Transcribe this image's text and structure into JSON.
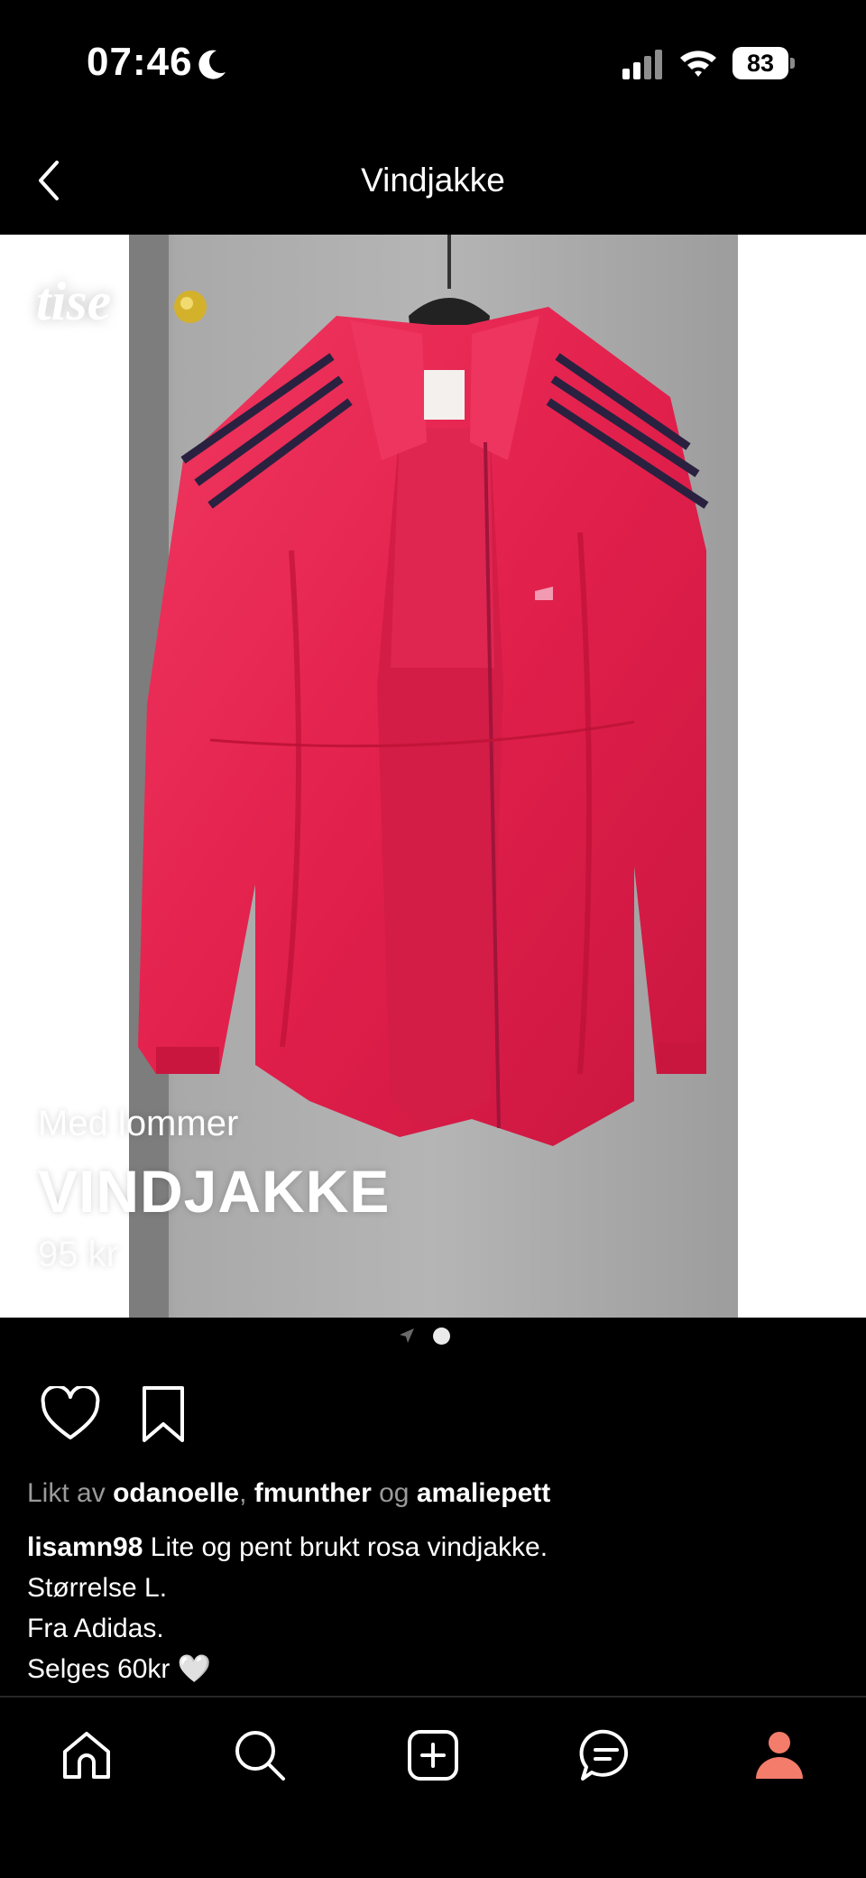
{
  "status_bar": {
    "time": "07:46",
    "battery": "83",
    "icons": [
      "moon-icon",
      "cellular-signal-icon",
      "wifi-icon",
      "battery-icon"
    ]
  },
  "header": {
    "title": "Vindjakke",
    "back_icon": "chevron-left-icon"
  },
  "post_image": {
    "logo": "tise",
    "subtitle": "Med lommer",
    "title": "VINDJAKKE",
    "price": "95 kr",
    "jacket_color": "#e8234e",
    "stripe_color": "#2a2140",
    "slide_count": 1
  },
  "actions": {
    "like_icon": "heart-icon",
    "save_icon": "bookmark-icon"
  },
  "likes": {
    "prefix": "Likt av",
    "user1": "odanoelle",
    "separator": ",",
    "user2": "fmunther",
    "conjunction": "og",
    "user3": "amaliepett"
  },
  "caption": {
    "username": "lisamn98",
    "line1": "Lite og pent brukt rosa vindjakke.",
    "line2": "Størrelse L.",
    "line3": "Fra Adidas.",
    "line4": "Selges 60kr 🤍"
  },
  "tab_bar": {
    "items": [
      "home-icon",
      "search-icon",
      "add-post-icon",
      "messages-icon",
      "profile-icon"
    ],
    "active_color": "#f47c6a"
  }
}
